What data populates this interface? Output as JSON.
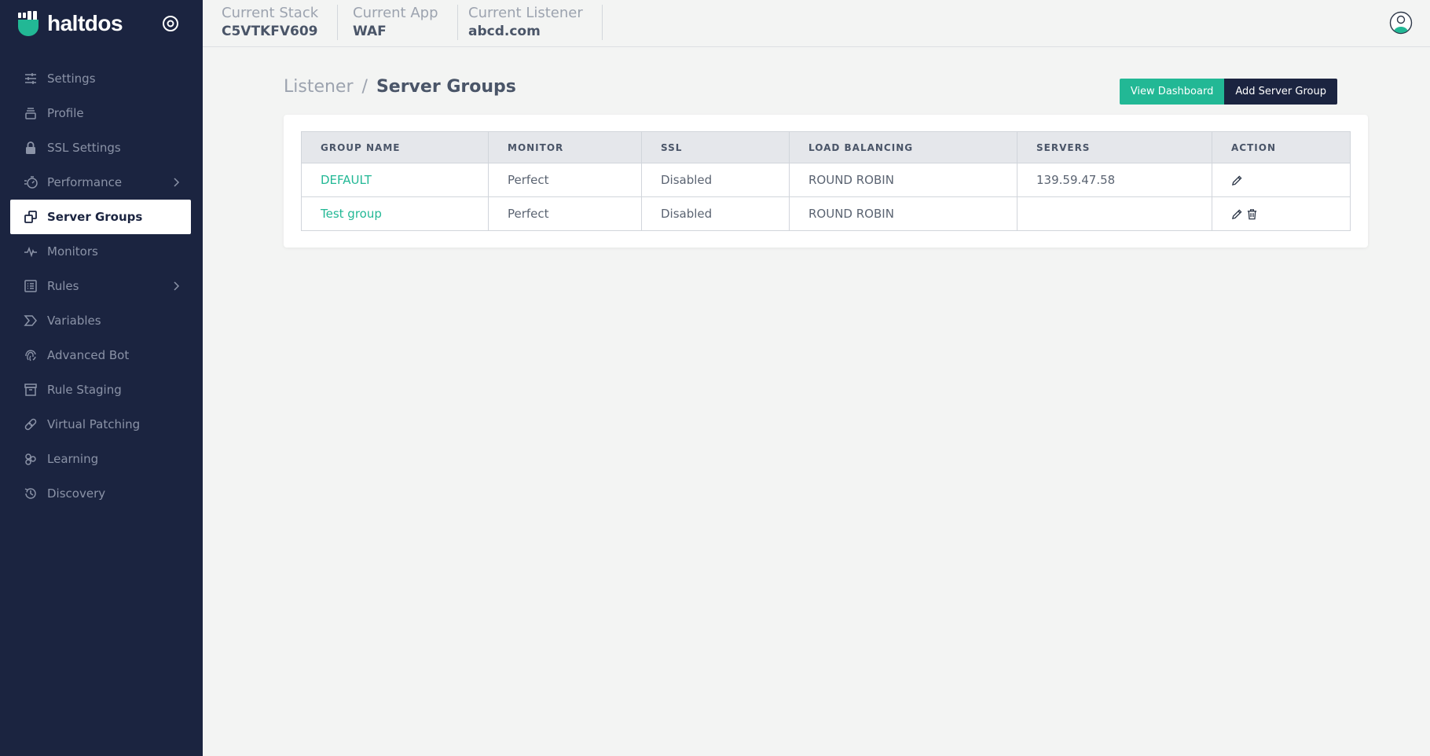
{
  "brand": {
    "name": "haltdos",
    "color": "#22b895"
  },
  "sidebar": {
    "items": [
      {
        "label": "Settings",
        "icon": "sliders-icon"
      },
      {
        "label": "Profile",
        "icon": "stack-icon"
      },
      {
        "label": "SSL Settings",
        "icon": "lock-icon"
      },
      {
        "label": "Performance",
        "icon": "speedometer-icon",
        "expandable": true
      },
      {
        "label": "Server Groups",
        "icon": "copy-icon",
        "active": true
      },
      {
        "label": "Monitors",
        "icon": "pulse-icon"
      },
      {
        "label": "Rules",
        "icon": "list-icon",
        "expandable": true
      },
      {
        "label": "Variables",
        "icon": "sigma-icon"
      },
      {
        "label": "Advanced Bot",
        "icon": "fingerprint-icon"
      },
      {
        "label": "Rule Staging",
        "icon": "archive-icon"
      },
      {
        "label": "Virtual Patching",
        "icon": "bandage-icon"
      },
      {
        "label": "Learning",
        "icon": "atom-icon"
      },
      {
        "label": "Discovery",
        "icon": "history-icon"
      }
    ]
  },
  "topbar": {
    "stack": {
      "label": "Current Stack",
      "value": "C5VTKFV609"
    },
    "app": {
      "label": "Current App",
      "value": "WAF"
    },
    "listener": {
      "label": "Current Listener",
      "value": "abcd.com"
    }
  },
  "page": {
    "breadcrumb_parent": "Listener",
    "breadcrumb_sep": "/",
    "title": "Server Groups",
    "view_dashboard_label": "View Dashboard",
    "add_server_group_label": "Add Server Group"
  },
  "table": {
    "headers": [
      "GROUP NAME",
      "MONITOR",
      "SSL",
      "LOAD BALANCING",
      "SERVERS",
      "ACTION"
    ],
    "rows": [
      {
        "group_name": "DEFAULT",
        "monitor": "Perfect",
        "ssl": "Disabled",
        "load_balancing": "ROUND ROBIN",
        "servers": "139.59.47.58",
        "actions": [
          "edit"
        ]
      },
      {
        "group_name": "Test group",
        "monitor": "Perfect",
        "ssl": "Disabled",
        "load_balancing": "ROUND ROBIN",
        "servers": "",
        "actions": [
          "edit",
          "delete"
        ]
      }
    ]
  },
  "colors": {
    "sidebar_bg": "#1b2440",
    "accent": "#22b895",
    "page_bg": "#f3f4f3"
  }
}
